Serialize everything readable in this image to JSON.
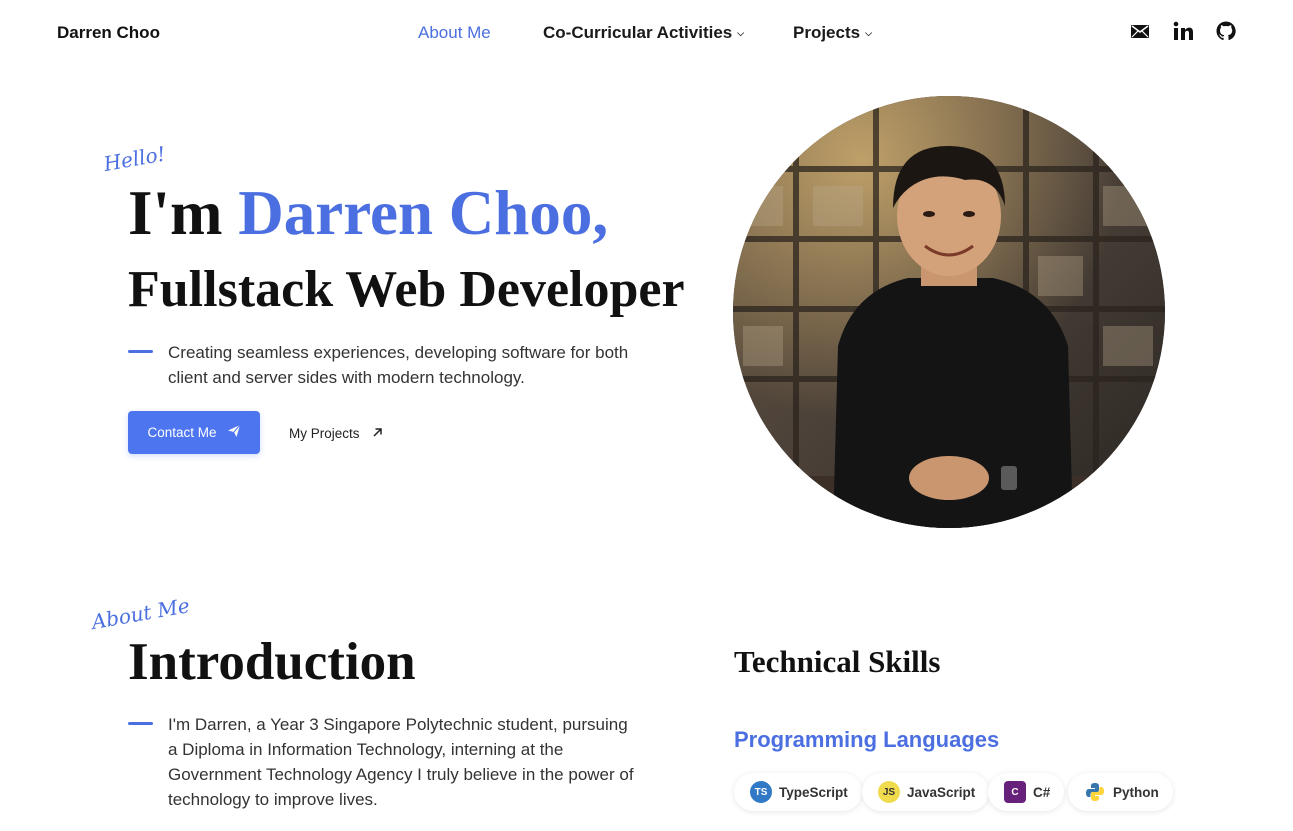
{
  "nav": {
    "brand": "Darren Choo",
    "links": [
      {
        "label": "About Me",
        "active": true
      },
      {
        "label": "Co-Curricular Activities",
        "has_dropdown": true
      },
      {
        "label": "Projects",
        "has_dropdown": true
      }
    ],
    "social_icons": [
      "mail-icon",
      "linkedin-icon",
      "github-icon"
    ]
  },
  "hero": {
    "greeting": "Hello!",
    "title_prefix": "I'm ",
    "name": "Darren Choo,",
    "subtitle": "Fullstack Web Developer",
    "description": "Creating seamless experiences, developing software for both client and server sides with modern technology.",
    "contact_button": "Contact Me",
    "projects_link": "My Projects"
  },
  "about": {
    "tag": "About Me",
    "title": "Introduction",
    "description": "I'm Darren, a Year 3 Singapore Polytechnic student, pursuing a Diploma in Information Technology, interning at the Government Technology Agency I truly believe in the power of technology to improve lives."
  },
  "skills": {
    "title": "Technical Skills",
    "category": "Programming Languages",
    "languages": [
      {
        "name": "TypeScript",
        "icon": "typescript-icon",
        "badge": "TS",
        "color": "#3178c6"
      },
      {
        "name": "JavaScript",
        "icon": "javascript-icon",
        "badge": "JS",
        "color": "#f0db4f"
      },
      {
        "name": "C#",
        "icon": "csharp-icon",
        "badge": "C",
        "color": "#68217a"
      },
      {
        "name": "Python",
        "icon": "python-icon",
        "color": "#3776ab"
      }
    ]
  },
  "colors": {
    "accent": "#4b6fe0",
    "button": "#4d75f0"
  }
}
